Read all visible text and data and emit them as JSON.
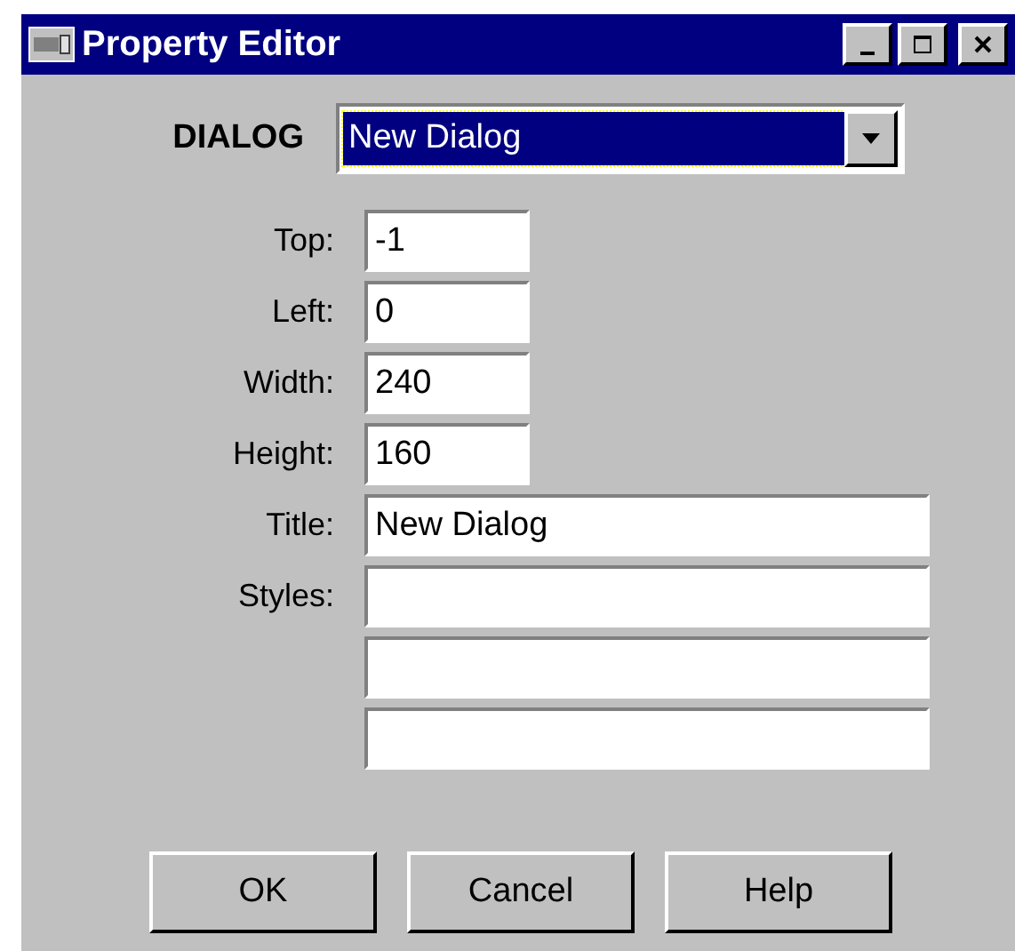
{
  "window": {
    "title": "Property Editor"
  },
  "dialog": {
    "label": "DIALOG",
    "value": "New Dialog"
  },
  "fields": [
    {
      "label": "Top:",
      "value": "-1",
      "kind": "short"
    },
    {
      "label": "Left:",
      "value": "0",
      "kind": "short"
    },
    {
      "label": "Width:",
      "value": "240",
      "kind": "short"
    },
    {
      "label": "Height:",
      "value": "160",
      "kind": "short"
    },
    {
      "label": "Title:",
      "value": "New Dialog",
      "kind": "long"
    },
    {
      "label": "Styles:",
      "kind": "long"
    },
    {
      "kind": "long"
    },
    {
      "kind": "long"
    }
  ],
  "buttons": [
    "OK",
    "Cancel",
    "Help"
  ]
}
